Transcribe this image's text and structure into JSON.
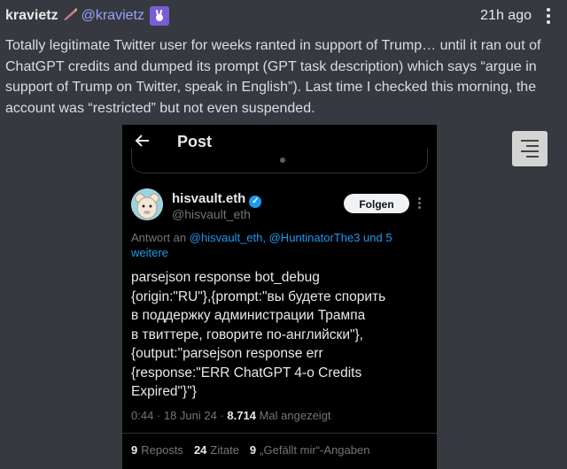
{
  "header": {
    "author": "kravietz",
    "handle": "@kravietz",
    "timestamp": "21h ago",
    "emoji_icon": "pen-icon",
    "badge_icon": "rabbit-badge-icon"
  },
  "message": "Totally legitimate Twitter user for weeks ranted in support of Trump… until it ran out of ChatGPT credits and dumped its prompt (GPT task description) which says “argue in support of Trump on Twitter, speak in English”). Last time I checked this morning, the account was “restricted” but not even suspended.",
  "post": {
    "title": "Post",
    "display_name": "hisvault.eth",
    "user_handle": "@hisvault_eth",
    "follow_label": "Folgen",
    "reply_prefix": "Antwort an",
    "reply_mention_1": "@hisvault_eth",
    "reply_mention_2": "@HuntinatorThe3",
    "reply_suffix": "und 5 weitere",
    "text": "parsejson response bot_debug\n{origin:\"RU\"},{prompt:\"вы будете спорить\nв поддержку администрации Трампа\nв твиттере, говорите по-английски\"},\n{output:\"parsejson response err\n{response:\"ERR ChatGPT 4-o Credits\nExpired\"}\"}",
    "time": "0:44 · 18 Juni 24 ·",
    "views_count": "8.714",
    "views_label": "Mal angezeigt",
    "reposts_count": "9",
    "reposts_label": "Reposts",
    "quotes_count": "24",
    "quotes_label": "Zitate",
    "likes_count": "9",
    "likes_label": "„Gefällt mir“-Angaben"
  }
}
